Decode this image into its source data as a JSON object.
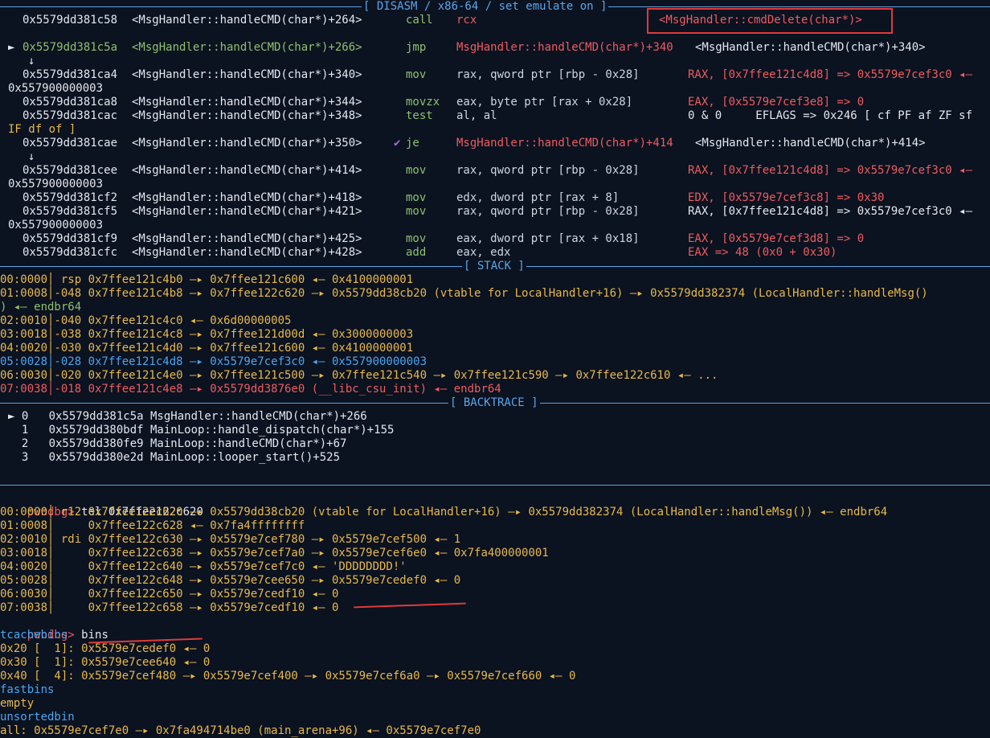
{
  "disasm": {
    "title": "[ DISASM / x86-64 / set emulate on ]",
    "rows": [
      {
        "arrow": "",
        "addr": "0x5579dd381c58",
        "sym": "<MsgHandler::handleCMD(char*)+264>",
        "op": "call",
        "args": "rcx",
        "cmt": "<MsgHandler::cmdDelete(char*)>"
      },
      {
        "arrow": "►",
        "addr": "0x5579dd381c5a",
        "sym": "<MsgHandler::handleCMD(char*)+266>",
        "op": "jmp",
        "args": "MsgHandler::handleCMD(char*)+340",
        "cmt": "<MsgHandler::handleCMD(char*)+340>"
      },
      {
        "arrow": "↓",
        "addr": "",
        "sym": "",
        "op": "",
        "args": "",
        "cmt": ""
      },
      {
        "arrow": "",
        "addr": "0x5579dd381ca4",
        "sym": "<MsgHandler::handleCMD(char*)+340>",
        "op": "mov",
        "args": "rax, qword ptr [rbp - 0x28]",
        "cmt": "RAX, [0x7ffee121c4d8] => 0x5579e7cef3c0 ◂—"
      },
      {
        "arrow": "",
        "addr": "0x557900000003",
        "sym": "",
        "op": "",
        "args": "",
        "cmt": ""
      },
      {
        "arrow": "",
        "addr": "0x5579dd381ca8",
        "sym": "<MsgHandler::handleCMD(char*)+344>",
        "op": "movzx",
        "args": "eax, byte ptr [rax + 0x28]",
        "cmt": "EAX, [0x5579e7cef3e8] => 0"
      },
      {
        "arrow": "",
        "addr": "0x5579dd381cac",
        "sym": "<MsgHandler::handleCMD(char*)+348>",
        "op": "test",
        "args": "al, al",
        "cmt": "0 & 0     EFLAGS => 0x246 [ cf PF af ZF sf"
      },
      {
        "arrow": "",
        "addr": "IF df of ]",
        "sym": "",
        "op": "",
        "args": "",
        "cmt": ""
      },
      {
        "arrow": "",
        "addr": "0x5579dd381cae",
        "sym": "<MsgHandler::handleCMD(char*)+350>",
        "op": "je",
        "args": "MsgHandler::handleCMD(char*)+414",
        "cmt": "<MsgHandler::handleCMD(char*)+414>"
      },
      {
        "arrow": "↓",
        "addr": "",
        "sym": "",
        "op": "",
        "args": "",
        "cmt": ""
      },
      {
        "arrow": "",
        "addr": "0x5579dd381cee",
        "sym": "<MsgHandler::handleCMD(char*)+414>",
        "op": "mov",
        "args": "rax, qword ptr [rbp - 0x28]",
        "cmt": "RAX, [0x7ffee121c4d8] => 0x5579e7cef3c0 ◂—"
      },
      {
        "arrow": "",
        "addr": "0x557900000003",
        "sym": "",
        "op": "",
        "args": "",
        "cmt": ""
      },
      {
        "arrow": "",
        "addr": "0x5579dd381cf2",
        "sym": "<MsgHandler::handleCMD(char*)+418>",
        "op": "mov",
        "args": "edx, dword ptr [rax + 8]",
        "cmt": "EDX, [0x5579e7cef3c8] => 0x30"
      },
      {
        "arrow": "",
        "addr": "0x5579dd381cf5",
        "sym": "<MsgHandler::handleCMD(char*)+421>",
        "op": "mov",
        "args": "rax, qword ptr [rbp - 0x28]",
        "cmt": "RAX, [0x7ffee121c4d8] => 0x5579e7cef3c0 ◂—"
      },
      {
        "arrow": "",
        "addr": "0x557900000003",
        "sym": "",
        "op": "",
        "args": "",
        "cmt": ""
      },
      {
        "arrow": "",
        "addr": "0x5579dd381cf9",
        "sym": "<MsgHandler::handleCMD(char*)+425>",
        "op": "mov",
        "args": "eax, dword ptr [rax + 0x18]",
        "cmt": "EAX, [0x5579e7cef3d8] => 0"
      },
      {
        "arrow": "",
        "addr": "0x5579dd381cfc",
        "sym": "<MsgHandler::handleCMD(char*)+428>",
        "op": "add",
        "args": "eax, edx",
        "cmt": "EAX => 48 (0x0 + 0x30)"
      }
    ]
  },
  "stack": {
    "title": "[ STACK ]",
    "rows": [
      "00:0000│ rsp 0x7ffee121c4b0 —▸ 0x7ffee121c600 ◂— 0x4100000001",
      "01:0008│-048 0x7ffee121c4b8 —▸ 0x7ffee122c620 —▸ 0x5579dd38cb20 (vtable for LocalHandler+16) —▸ 0x5579dd382374 (LocalHandler::handleMsg()",
      ") ◂— endbr64",
      "02:0010│-040 0x7ffee121c4c0 ◂— 0x6d00000005",
      "03:0018│-038 0x7ffee121c4c8 —▸ 0x7ffee121d00d ◂— 0x3000000003",
      "04:0020│-030 0x7ffee121c4d0 —▸ 0x7ffee121c600 ◂— 0x4100000001",
      "05:0028│-028 0x7ffee121c4d8 —▸ 0x5579e7cef3c0 ◂— 0x557900000003",
      "06:0030│-020 0x7ffee121c4e0 —▸ 0x7ffee121c500 —▸ 0x7ffee121c540 —▸ 0x7ffee121c590 —▸ 0x7ffee122c610 ◂— ...",
      "07:0038│-018 0x7ffee121c4e8 —▸ 0x5579dd3876e0 (__libc_csu_init) ◂— endbr64"
    ]
  },
  "backtrace": {
    "title": "[ BACKTRACE ]",
    "rows": [
      "► 0   0x5579dd381c5a MsgHandler::handleCMD(char*)+266",
      "  1   0x5579dd380bdf MainLoop::handle_dispatch(char*)+155",
      "  2   0x5579dd380fe9 MainLoop::handleCMD(char*)+67",
      "  3   0x5579dd380e2d MainLoop::looper_start()+525"
    ]
  },
  "console": {
    "prompt": "pwndbg>",
    "cmd1": "tel 0x7ffee122c620",
    "tel_rows": [
      "00:0000│ r12 0x7ffee122c620 —▸ 0x5579dd38cb20 (vtable for LocalHandler+16) —▸ 0x5579dd382374 (LocalHandler::handleMsg()) ◂— endbr64",
      "01:0008│     0x7ffee122c628 ◂— 0x7fa4ffffffff",
      "02:0010│ rdi 0x7ffee122c630 —▸ 0x5579e7cef780 —▸ 0x5579e7cef500 ◂— 1",
      "03:0018│     0x7ffee122c638 —▸ 0x5579e7cef7a0 —▸ 0x5579e7cef6e0 ◂— 0x7fa400000001",
      "04:0020│     0x7ffee122c640 —▸ 0x5579e7cef7c0 ◂— 'DDDDDDDD!'",
      "05:0028│     0x7ffee122c648 —▸ 0x5579e7cee650 —▸ 0x5579e7cedef0 ◂— 0",
      "06:0030│     0x7ffee122c650 —▸ 0x5579e7cedf10 ◂— 0",
      "07:0038│     0x7ffee122c658 —▸ 0x5579e7cedf10 ◂— 0"
    ],
    "cmd2": "bins",
    "bins": [
      "tcachebins",
      "0x20 [  1]: 0x5579e7cedef0 ◂— 0",
      "0x30 [  1]: 0x5579e7cee640 ◂— 0",
      "0x40 [  4]: 0x5579e7cef480 —▸ 0x5579e7cef400 —▸ 0x5579e7cef6a0 —▸ 0x5579e7cef660 ◂— 0",
      "fastbins",
      "empty",
      "unsortedbin",
      "all: 0x5579e7cef7e0 —▸ 0x7fa494714be0 (main_arena+96) ◂— 0x5579e7cef7e0"
    ]
  },
  "colors": {
    "background": "#0b1220",
    "separator": "#5aa6ea",
    "highlight_box": "#e03a3a"
  }
}
